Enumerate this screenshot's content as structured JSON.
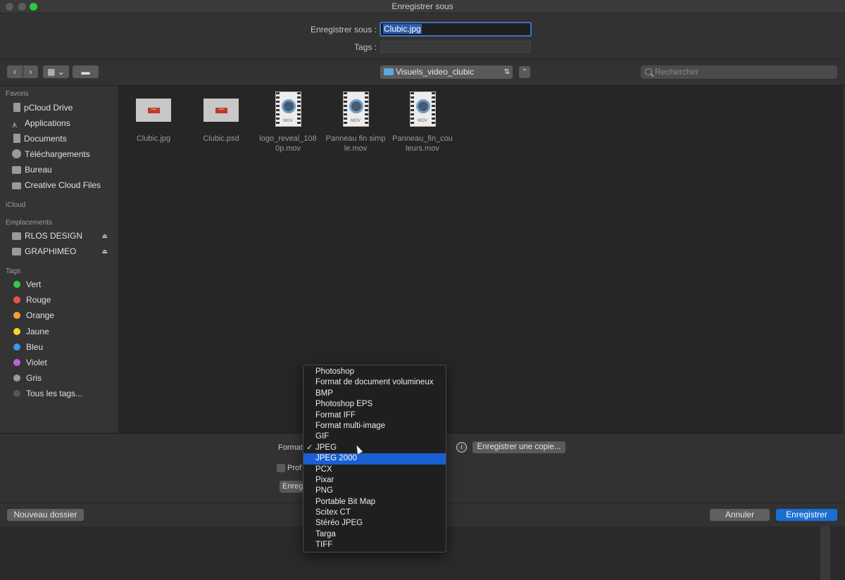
{
  "window": {
    "title": "Enregistrer sous"
  },
  "save_as": {
    "label": "Enregistrer sous :",
    "value": "Clubic.jpg"
  },
  "tags": {
    "label": "Tags :",
    "value": ""
  },
  "toolbar": {
    "back_icon": "chevron-left-icon",
    "forward_icon": "chevron-right-icon",
    "view_icon": "grid-view-icon",
    "new_folder_icon": "folder-icon",
    "path": "Visuels_video_clubic",
    "collapse_icon": "chevron-up-icon",
    "search_placeholder": "Rechercher"
  },
  "sidebar": {
    "sections": {
      "favorites": "Favoris",
      "icloud": "iCloud",
      "locations": "Emplacements",
      "tags": "Tags"
    },
    "favorites": [
      {
        "label": "pCloud Drive",
        "icon": "document-icon"
      },
      {
        "label": "Applications",
        "icon": "applications-icon"
      },
      {
        "label": "Documents",
        "icon": "document-icon"
      },
      {
        "label": "Téléchargements",
        "icon": "download-icon"
      },
      {
        "label": "Bureau",
        "icon": "desktop-icon"
      },
      {
        "label": "Creative Cloud Files",
        "icon": "folder-icon"
      }
    ],
    "locations": [
      {
        "label": "RLOS DESIGN",
        "icon": "drive-icon",
        "eject": "⏏"
      },
      {
        "label": "GRAPHIMEO",
        "icon": "drive-icon",
        "eject": "⏏"
      }
    ],
    "tags": [
      {
        "label": "Vert",
        "color": "#34c84a"
      },
      {
        "label": "Rouge",
        "color": "#f0504a"
      },
      {
        "label": "Orange",
        "color": "#f5a030"
      },
      {
        "label": "Jaune",
        "color": "#f5d530"
      },
      {
        "label": "Bleu",
        "color": "#3d96f0"
      },
      {
        "label": "Violet",
        "color": "#c060e0"
      },
      {
        "label": "Gris",
        "color": "#9a9a9a"
      },
      {
        "label": "Tous les tags...",
        "color": "#555555"
      }
    ]
  },
  "files": [
    {
      "name": "Clubic.jpg",
      "type": "image",
      "badge": "clubic"
    },
    {
      "name": "Clubic.psd",
      "type": "image",
      "badge": "clubic"
    },
    {
      "name": "logo_reveal_1080p.mov",
      "type": "movie",
      "badge": "MOV"
    },
    {
      "name": "Panneau fin simple.mov",
      "type": "movie",
      "badge": "MOV"
    },
    {
      "name": "Panneau_fin_couleurs.mov",
      "type": "movie",
      "badge": "MOV"
    }
  ],
  "options": {
    "format_label": "Format",
    "profile_label": "Prof",
    "save_partial_label": "Enreg",
    "info_icon": "info-icon",
    "save_copy_label": "Enregistrer une copie..."
  },
  "format_menu": {
    "checked": "JPEG",
    "highlighted": "JPEG 2000",
    "items": [
      "Photoshop",
      "Format de document volumineux",
      "BMP",
      "Photoshop EPS",
      "Format IFF",
      "Format multi-image",
      "GIF",
      "JPEG",
      "JPEG 2000",
      "PCX",
      "Pixar",
      "PNG",
      "Portable Bit Map",
      "Scitex CT",
      "Stéréo JPEG",
      "Targa",
      "TIFF"
    ]
  },
  "buttons": {
    "new_folder": "Nouveau dossier",
    "cancel": "Annuler",
    "save": "Enregistrer"
  }
}
